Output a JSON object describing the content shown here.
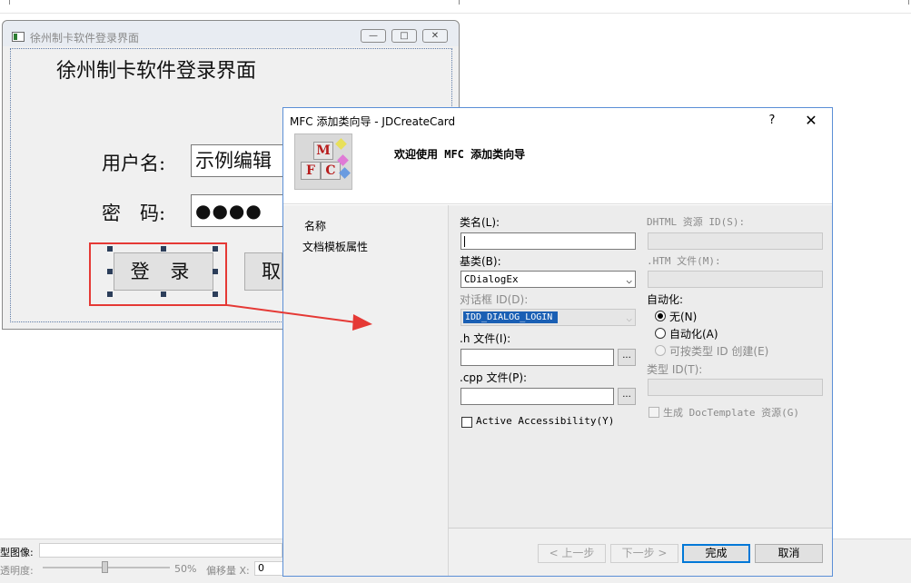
{
  "design_dialog": {
    "window_title": "徐州制卡软件登录界面",
    "heading": "徐州制卡软件登录界面",
    "username_label": "用户名:",
    "username_value": "示例编辑",
    "password_label": "密　码:",
    "password_value": "●●●●",
    "login_button": "登 录",
    "cancel_button": "取"
  },
  "bottom_panel": {
    "image_label": "型图像:",
    "opacity_label": "透明度:",
    "opacity_percent": "50%",
    "offset_x_label": "偏移量 X:",
    "offset_x_value": "0"
  },
  "wizard": {
    "title": "MFC 添加类向导 - JDCreateCard",
    "help": "?",
    "close": "✕",
    "heading": "欢迎使用 MFC 添加类向导",
    "logo_letters": [
      "M",
      "F",
      "C"
    ],
    "nav": [
      "名称",
      "文档模板属性"
    ],
    "class_name_label": "类名(L):",
    "class_name_value": "",
    "base_class_label": "基类(B):",
    "base_class_value": "CDialogEx",
    "dialog_id_label": "对话框 ID(D):",
    "dialog_id_value": "IDD_DIALOG_LOGIN",
    "h_file_label": ".h 文件(I):",
    "cpp_file_label": ".cpp 文件(P):",
    "browse": "...",
    "active_accessibility_label": "Active Accessibility(Y)",
    "dhtml_id_label": "DHTML 资源 ID(S):",
    "htm_file_label": ".HTM 文件(M):",
    "automation_label": "自动化:",
    "automation_options": [
      "无(N)",
      "自动化(A)",
      "可按类型 ID 创建(E)"
    ],
    "type_id_label": "类型 ID(T):",
    "doctemplate_label": "生成 DocTemplate 资源(G)",
    "buttons": {
      "prev": "< 上一步",
      "next": "下一步 >",
      "finish": "完成",
      "cancel": "取消"
    }
  },
  "colors": {
    "highlight_red": "#e53935",
    "selection_blue": "#1a5fb4",
    "wizard_border": "#5b8fd6"
  }
}
